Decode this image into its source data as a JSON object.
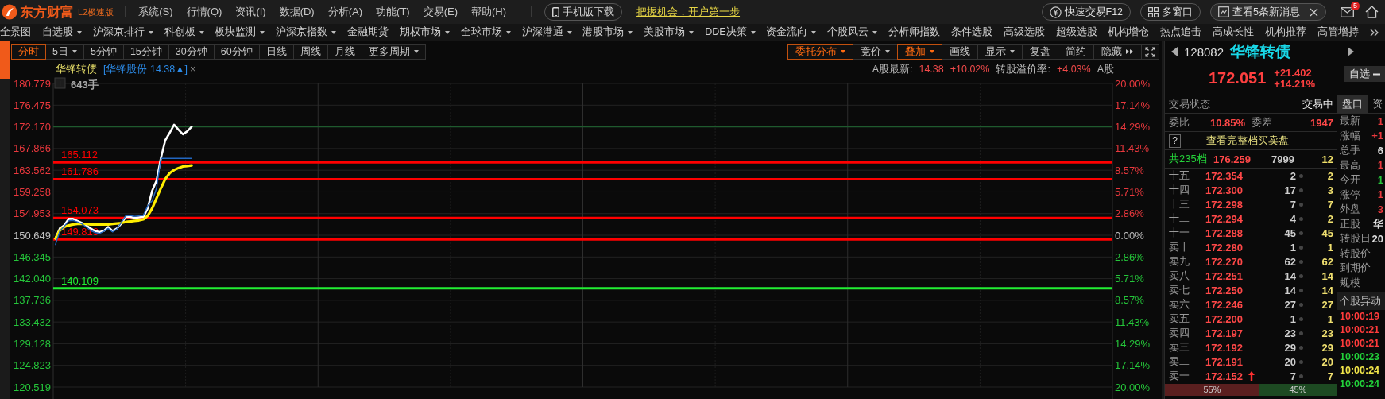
{
  "top_bar": {
    "logo": "东方财富",
    "edition": "L2极速版",
    "menus": [
      "系统(S)",
      "行情(Q)",
      "资讯(I)",
      "数据(D)",
      "分析(A)",
      "功能(T)",
      "交易(E)",
      "帮助(H)"
    ],
    "mobile_download": "手机版下载",
    "promo": "把握机会，开户第一步",
    "quick_trade": "快速交易F12",
    "multi_window": "多窗口",
    "news": "查看5条新消息",
    "mail_badge": "5"
  },
  "nav": [
    {
      "label": "全景图",
      "dropdown": false
    },
    {
      "label": "自选股",
      "dropdown": true
    },
    {
      "label": "沪深京排行",
      "dropdown": true
    },
    {
      "label": "科创板",
      "dropdown": true
    },
    {
      "label": "板块监测",
      "dropdown": true
    },
    {
      "label": "沪深京指数",
      "dropdown": true
    },
    {
      "label": "金融期货",
      "dropdown": false
    },
    {
      "label": "期权市场",
      "dropdown": true
    },
    {
      "label": "全球市场",
      "dropdown": true
    },
    {
      "label": "沪深港通",
      "dropdown": true
    },
    {
      "label": "港股市场",
      "dropdown": true
    },
    {
      "label": "美股市场",
      "dropdown": true
    },
    {
      "label": "DDE决策",
      "dropdown": true
    },
    {
      "label": "资金流向",
      "dropdown": true
    },
    {
      "label": "个股风云",
      "dropdown": true
    },
    {
      "label": "分析师指数",
      "dropdown": false
    },
    {
      "label": "条件选股",
      "dropdown": false
    },
    {
      "label": "高级选股",
      "dropdown": false
    },
    {
      "label": "超级选股",
      "dropdown": false
    },
    {
      "label": "机构增仓",
      "dropdown": false
    },
    {
      "label": "热点追击",
      "dropdown": false
    },
    {
      "label": "高成长性",
      "dropdown": false
    },
    {
      "label": "机构推荐",
      "dropdown": false
    },
    {
      "label": "高管增持",
      "dropdown": false
    }
  ],
  "period_tabs": [
    {
      "label": "分时",
      "selected": true,
      "dropdown": false
    },
    {
      "label": "5日",
      "selected": false,
      "dropdown": true
    },
    {
      "label": "5分钟",
      "selected": false,
      "dropdown": false
    },
    {
      "label": "15分钟",
      "selected": false,
      "dropdown": false
    },
    {
      "label": "30分钟",
      "selected": false,
      "dropdown": false
    },
    {
      "label": "60分钟",
      "selected": false,
      "dropdown": false
    },
    {
      "label": "日线",
      "selected": false,
      "dropdown": false
    },
    {
      "label": "周线",
      "selected": false,
      "dropdown": false
    },
    {
      "label": "月线",
      "selected": false,
      "dropdown": false
    },
    {
      "label": "更多周期",
      "selected": false,
      "dropdown": true
    }
  ],
  "chart_tools": [
    {
      "label": "委托分布",
      "active": true,
      "dropdown": true
    },
    {
      "label": "竞价",
      "active": false,
      "dropdown": true
    },
    {
      "label": "叠加",
      "active": true,
      "dropdown": true
    },
    {
      "label": "画线",
      "active": false,
      "dropdown": false
    },
    {
      "label": "显示",
      "active": false,
      "dropdown": true
    },
    {
      "label": "复盘",
      "active": false,
      "dropdown": false
    },
    {
      "label": "简约",
      "active": false,
      "dropdown": false
    },
    {
      "label": "隐藏",
      "active": false,
      "dropdown": false
    }
  ],
  "chart": {
    "title": "华锋转债",
    "overlay": "[华锋股份 14.38▲]",
    "close": "×",
    "add": "+",
    "volume_label": "643手",
    "a_share_info": [
      {
        "text": "A股最新:",
        "color": "#bdbdbd"
      },
      {
        "text": "14.38",
        "color": "#ef4a4a"
      },
      {
        "text": "+10.02%",
        "color": "#ef4a4a"
      },
      {
        "text": "转股溢价率:",
        "color": "#bdbdbd"
      },
      {
        "text": "+4.03%",
        "color": "#ef4a4a"
      },
      {
        "text": "A股",
        "color": "#bdbdbd"
      }
    ],
    "percent_axis": [
      {
        "label": "20.00%",
        "color": "#e8383d"
      },
      {
        "label": "17.14%",
        "color": "#e8383d"
      },
      {
        "label": "14.29%",
        "color": "#e8383d"
      },
      {
        "label": "11.43%",
        "color": "#e8383d"
      },
      {
        "label": "8.57%",
        "color": "#e8383d"
      },
      {
        "label": "5.71%",
        "color": "#e8383d"
      },
      {
        "label": "2.86%",
        "color": "#e8383d"
      },
      {
        "label": "0.00%",
        "color": "#bdbdbd"
      },
      {
        "label": "2.86%",
        "color": "#25c53a"
      },
      {
        "label": "5.71%",
        "color": "#25c53a"
      },
      {
        "label": "8.57%",
        "color": "#25c53a"
      },
      {
        "label": "11.43%",
        "color": "#25c53a"
      },
      {
        "label": "14.29%",
        "color": "#25c53a"
      },
      {
        "label": "17.14%",
        "color": "#25c53a"
      },
      {
        "label": "20.00%",
        "color": "#25c53a"
      }
    ],
    "chart_data": {
      "type": "line",
      "grid": true,
      "categories": [
        null,
        null,
        null,
        null,
        null,
        null,
        null,
        null,
        null,
        null,
        null,
        null,
        null,
        null,
        null,
        null,
        null,
        null,
        null,
        null,
        null,
        null,
        null,
        null,
        null,
        null,
        null,
        null,
        null,
        null,
        null,
        null,
        null,
        null,
        null,
        null,
        null,
        null,
        null,
        null,
        null,
        null,
        null,
        null,
        null,
        null,
        null,
        null,
        null,
        null,
        null,
        null,
        null,
        null,
        null,
        null,
        null,
        null,
        null,
        null,
        null,
        null,
        null,
        null,
        null,
        null,
        null,
        null,
        null,
        null,
        null,
        null,
        null,
        null,
        null,
        null,
        null,
        null,
        null,
        null,
        null,
        null,
        null,
        null,
        null,
        null,
        null,
        null,
        null,
        null,
        null,
        null,
        null,
        null,
        null,
        null,
        null,
        null,
        null,
        null,
        null,
        null,
        null,
        null,
        null,
        null,
        null,
        null,
        null,
        null,
        null,
        null,
        null,
        null,
        null,
        null,
        null,
        null,
        null,
        null,
        null,
        null,
        null,
        null,
        null,
        null,
        null,
        null,
        null,
        null,
        null,
        null,
        null,
        null,
        null,
        null,
        null,
        null,
        null,
        null,
        null,
        null,
        null,
        null,
        null,
        null,
        null,
        null,
        null,
        null,
        null,
        null,
        null,
        null,
        null,
        null,
        null,
        null,
        null,
        null,
        null,
        null,
        null,
        null,
        null,
        null,
        null,
        null,
        null,
        null,
        null,
        null,
        null,
        null,
        null,
        null,
        null,
        null,
        null,
        null,
        null,
        null,
        null,
        null,
        null,
        null,
        null,
        null,
        null,
        null,
        null,
        null,
        null,
        null,
        null,
        null,
        null,
        null,
        null,
        null,
        null,
        null,
        null,
        null,
        null,
        null,
        null,
        null,
        null,
        null,
        null,
        null,
        null,
        null,
        null,
        null,
        null,
        null,
        null,
        null,
        null,
        null,
        null,
        null,
        null,
        null,
        null,
        null,
        null,
        null,
        null,
        null,
        null,
        null,
        null,
        null,
        null,
        null,
        null,
        null,
        null
      ],
      "ylim": [
        120.519,
        180.779
      ],
      "ref_lines": [
        {
          "axis": "y",
          "value": 172.17,
          "color": "#1f5a2e"
        },
        {
          "axis": "y",
          "value": 165.112,
          "label": "165.112",
          "color": "#ff0000"
        },
        {
          "axis": "y",
          "value": 161.786,
          "label": "161.786",
          "color": "#ff0000"
        },
        {
          "axis": "y",
          "value": 154.073,
          "label": "154.073",
          "color": "#ff0000"
        },
        {
          "axis": "y",
          "value": 149.813,
          "label": "149.813",
          "color": "#ff0000"
        },
        {
          "axis": "y",
          "value": 140.109,
          "label": "140.109",
          "color": "#22ee33"
        }
      ],
      "yticks": [
        {
          "value": 180.779,
          "label": "180.779"
        },
        {
          "value": 176.475,
          "label": "176.475"
        },
        {
          "value": 172.17,
          "label": "172.170"
        },
        {
          "value": 167.866,
          "label": "167.866"
        },
        {
          "value": 163.562,
          "label": "163.562"
        },
        {
          "value": 159.258,
          "label": "159.258"
        },
        {
          "value": 154.953,
          "label": "154.953"
        },
        {
          "value": 150.649,
          "label": "150.649"
        },
        {
          "value": 146.345,
          "label": "146.345"
        },
        {
          "value": 142.04,
          "label": "142.040"
        },
        {
          "value": 137.736,
          "label": "137.736"
        },
        {
          "value": 133.432,
          "label": "133.432"
        },
        {
          "value": 129.128,
          "label": "129.128"
        },
        {
          "value": 124.823,
          "label": "124.823"
        },
        {
          "value": 120.519,
          "label": "120.519"
        }
      ],
      "series": [
        {
          "color": "#ffffff",
          "values": [
            150.0,
            152.0,
            152.6,
            153.9,
            153.9,
            153.5,
            153.1,
            152.6,
            152.0,
            151.5,
            151.3,
            151.5,
            152.3,
            151.5,
            152.0,
            153.0,
            154.3,
            154.3,
            154.1,
            154.2,
            154.3,
            156.0,
            159.5,
            161.5,
            166.0,
            169.5,
            171.0,
            172.6,
            171.6,
            170.7,
            171.3,
            172.2,
            null,
            null,
            null,
            null,
            null,
            null,
            null,
            null,
            null,
            null,
            null,
            null,
            null,
            null,
            null,
            null,
            null,
            null,
            null,
            null,
            null,
            null,
            null,
            null,
            null,
            null,
            null,
            null,
            null,
            null,
            null,
            null,
            null,
            null,
            null,
            null,
            null,
            null,
            null,
            null,
            null,
            null,
            null,
            null,
            null,
            null,
            null,
            null,
            null,
            null,
            null,
            null,
            null,
            null,
            null,
            null,
            null,
            null,
            null,
            null,
            null,
            null,
            null,
            null,
            null,
            null,
            null,
            null,
            null,
            null,
            null,
            null,
            null,
            null,
            null,
            null,
            null,
            null,
            null,
            null,
            null,
            null,
            null,
            null,
            null,
            null,
            null,
            null,
            null,
            null,
            null,
            null,
            null,
            null,
            null,
            null,
            null,
            null,
            null,
            null,
            null,
            null,
            null,
            null,
            null,
            null,
            null,
            null,
            null,
            null,
            null,
            null,
            null,
            null,
            null,
            null,
            null,
            null,
            null,
            null,
            null,
            null,
            null,
            null,
            null,
            null,
            null,
            null,
            null,
            null,
            null,
            null,
            null,
            null,
            null,
            null,
            null,
            null,
            null,
            null,
            null,
            null,
            null,
            null,
            null,
            null,
            null,
            null,
            null,
            null,
            null,
            null,
            null,
            null,
            null,
            null,
            null,
            null,
            null,
            null,
            null,
            null,
            null,
            null,
            null,
            null,
            null,
            null,
            null,
            null,
            null,
            null,
            null,
            null,
            null,
            null,
            null,
            null,
            null,
            null,
            null,
            null,
            null,
            null,
            null,
            null,
            null,
            null,
            null,
            null,
            null,
            null,
            null,
            null,
            null,
            null,
            null,
            null,
            null,
            null,
            null,
            null,
            null,
            null,
            null,
            null,
            null,
            null,
            null
          ]
        },
        {
          "color": "#ffee00",
          "values": [
            150.0,
            151.6,
            152.3,
            152.6,
            152.8,
            152.9,
            152.9,
            152.9,
            152.8,
            152.8,
            152.8,
            152.8,
            152.8,
            152.9,
            153.0,
            153.1,
            153.3,
            153.4,
            153.5,
            153.6,
            153.8,
            154.5,
            156.0,
            158.0,
            160.0,
            161.8,
            163.0,
            163.6,
            164.0,
            164.3,
            164.4,
            164.5,
            null,
            null,
            null,
            null,
            null,
            null,
            null,
            null,
            null,
            null,
            null,
            null,
            null,
            null,
            null,
            null,
            null,
            null,
            null,
            null,
            null,
            null,
            null,
            null,
            null,
            null,
            null,
            null,
            null,
            null,
            null,
            null,
            null,
            null,
            null,
            null,
            null,
            null,
            null,
            null,
            null,
            null,
            null,
            null,
            null,
            null,
            null,
            null,
            null,
            null,
            null,
            null,
            null,
            null,
            null,
            null,
            null,
            null,
            null,
            null,
            null,
            null,
            null,
            null,
            null,
            null,
            null,
            null,
            null,
            null,
            null,
            null,
            null,
            null,
            null,
            null,
            null,
            null,
            null,
            null,
            null,
            null,
            null,
            null,
            null,
            null,
            null,
            null,
            null,
            null,
            null,
            null,
            null,
            null,
            null,
            null,
            null,
            null,
            null,
            null,
            null,
            null,
            null,
            null,
            null,
            null,
            null,
            null,
            null,
            null,
            null,
            null,
            null,
            null,
            null,
            null,
            null,
            null,
            null,
            null,
            null,
            null,
            null,
            null,
            null,
            null,
            null,
            null,
            null,
            null,
            null,
            null,
            null,
            null,
            null,
            null,
            null,
            null,
            null,
            null,
            null,
            null,
            null,
            null,
            null,
            null,
            null,
            null,
            null,
            null,
            null,
            null,
            null,
            null,
            null,
            null,
            null,
            null,
            null,
            null,
            null,
            null,
            null,
            null,
            null,
            null,
            null,
            null,
            null,
            null,
            null,
            null,
            null,
            null,
            null,
            null,
            null,
            null,
            null,
            null,
            null,
            null,
            null,
            null,
            null,
            null,
            null,
            null,
            null,
            null,
            null,
            null,
            null,
            null,
            null,
            null,
            null,
            null,
            null,
            null,
            null,
            null,
            null,
            null,
            null,
            null,
            null,
            null,
            null
          ]
        },
        {
          "color": "#2266c0",
          "values": [
            148.8,
            151.5,
            152.4,
            153.5,
            153.6,
            153.3,
            152.9,
            152.3,
            151.6,
            151.2,
            151.0,
            151.4,
            152.0,
            151.3,
            151.9,
            153.2,
            154.5,
            154.6,
            154.4,
            154.5,
            154.6,
            156.5,
            157.5,
            160.0,
            165.9,
            165.9,
            165.9,
            165.9,
            165.9,
            165.9,
            165.9,
            165.9,
            null,
            null,
            null,
            null,
            null,
            null,
            null,
            null,
            null,
            null,
            null,
            null,
            null,
            null,
            null,
            null,
            null,
            null,
            null,
            null,
            null,
            null,
            null,
            null,
            null,
            null,
            null,
            null,
            null,
            null,
            null,
            null,
            null,
            null,
            null,
            null,
            null,
            null,
            null,
            null,
            null,
            null,
            null,
            null,
            null,
            null,
            null,
            null,
            null,
            null,
            null,
            null,
            null,
            null,
            null,
            null,
            null,
            null,
            null,
            null,
            null,
            null,
            null,
            null,
            null,
            null,
            null,
            null,
            null,
            null,
            null,
            null,
            null,
            null,
            null,
            null,
            null,
            null,
            null,
            null,
            null,
            null,
            null,
            null,
            null,
            null,
            null,
            null,
            null,
            null,
            null,
            null,
            null,
            null,
            null,
            null,
            null,
            null,
            null,
            null,
            null,
            null,
            null,
            null,
            null,
            null,
            null,
            null,
            null,
            null,
            null,
            null,
            null,
            null,
            null,
            null,
            null,
            null,
            null,
            null,
            null,
            null,
            null,
            null,
            null,
            null,
            null,
            null,
            null,
            null,
            null,
            null,
            null,
            null,
            null,
            null,
            null,
            null,
            null,
            null,
            null,
            null,
            null,
            null,
            null,
            null,
            null,
            null,
            null,
            null,
            null,
            null,
            null,
            null,
            null,
            null,
            null,
            null,
            null,
            null,
            null,
            null,
            null,
            null,
            null,
            null,
            null,
            null,
            null,
            null,
            null,
            null,
            null,
            null,
            null,
            null,
            null,
            null,
            null,
            null,
            null,
            null,
            null,
            null,
            null,
            null,
            null,
            null,
            null,
            null,
            null,
            null,
            null,
            null,
            null,
            null,
            null,
            null,
            null,
            null,
            null,
            null,
            null,
            null,
            null,
            null,
            null,
            null,
            null
          ]
        }
      ]
    }
  },
  "quote": {
    "code": "128082",
    "name": "华锋转债",
    "price": "172.051",
    "change": "+21.402",
    "change_pct": "+14.21%",
    "watch": "自选"
  },
  "book": {
    "status_label": "交易状态",
    "status_value": "交易中",
    "ratio_label": "委比",
    "ratio_value": "10.85%",
    "diff_label": "委差",
    "diff_value": "1947",
    "help": "?",
    "full_book": "查看完整档买卖盘",
    "total_label": "共235档",
    "total_price": "176.259",
    "total_volume": "7999",
    "total_count": "12",
    "asks": [
      {
        "level": "十五",
        "price": "172.354",
        "volume": "2",
        "count": "2",
        "uptick": false
      },
      {
        "level": "十四",
        "price": "172.300",
        "volume": "17",
        "count": "3",
        "uptick": false
      },
      {
        "level": "十三",
        "price": "172.298",
        "volume": "7",
        "count": "7",
        "uptick": false
      },
      {
        "level": "十二",
        "price": "172.294",
        "volume": "4",
        "count": "2",
        "uptick": false
      },
      {
        "level": "十一",
        "price": "172.288",
        "volume": "45",
        "count": "45",
        "uptick": false
      },
      {
        "level": "卖十",
        "price": "172.280",
        "volume": "1",
        "count": "1",
        "uptick": false
      },
      {
        "level": "卖九",
        "price": "172.270",
        "volume": "62",
        "count": "62",
        "uptick": false
      },
      {
        "level": "卖八",
        "price": "172.251",
        "volume": "14",
        "count": "14",
        "uptick": false
      },
      {
        "level": "卖七",
        "price": "172.250",
        "volume": "14",
        "count": "14",
        "uptick": false
      },
      {
        "level": "卖六",
        "price": "172.246",
        "volume": "27",
        "count": "27",
        "uptick": false
      },
      {
        "level": "卖五",
        "price": "172.200",
        "volume": "1",
        "count": "1",
        "uptick": false
      },
      {
        "level": "卖四",
        "price": "172.197",
        "volume": "23",
        "count": "23",
        "uptick": false
      },
      {
        "level": "卖三",
        "price": "172.192",
        "volume": "29",
        "count": "29",
        "uptick": false
      },
      {
        "level": "卖二",
        "price": "172.191",
        "volume": "20",
        "count": "20",
        "uptick": false
      },
      {
        "level": "卖一",
        "price": "172.152",
        "volume": "7",
        "count": "7",
        "uptick": true
      }
    ],
    "ratio_bar": [
      {
        "label": "55%",
        "level": 0.55,
        "color": "#5a1f1f"
      },
      {
        "label": "45%",
        "level": 0.45,
        "color": "#1d4a22"
      }
    ]
  },
  "side": {
    "tabs": [
      {
        "label": "盘口",
        "selected": true
      },
      {
        "label": "资",
        "selected": false
      }
    ],
    "fields": [
      {
        "label": "最新",
        "value": "1",
        "color": "#e8383d"
      },
      {
        "label": "涨幅",
        "value": "+1",
        "color": "#e8383d"
      },
      {
        "label": "总手",
        "value": "6",
        "color": "#dddddd"
      },
      {
        "label": "最高",
        "value": "1",
        "color": "#e8383d"
      },
      {
        "label": "今开",
        "value": "1",
        "color": "#25c53a"
      },
      {
        "label": "涨停",
        "value": "1",
        "color": "#e8383d"
      },
      {
        "label": "外盘",
        "value": "3",
        "color": "#e8383d"
      },
      {
        "label": "正股",
        "value": "华",
        "color": "#dddddd"
      },
      {
        "label": "转股日",
        "value": "20",
        "color": "#dddddd"
      },
      {
        "label": "转股价"
      },
      {
        "label": "到期价"
      },
      {
        "label": "规模"
      }
    ],
    "alerts_title": "个股异动",
    "alerts": [
      {
        "time": "10:00:19",
        "color": "#ff3b3b"
      },
      {
        "time": "10:00:21",
        "color": "#ff3b3b"
      },
      {
        "time": "10:00:21",
        "color": "#ff3b3b"
      },
      {
        "time": "10:00:23",
        "color": "#22d23a"
      },
      {
        "time": "10:00:24",
        "color": "#f2e64a"
      },
      {
        "time": "10:00:24",
        "color": "#22d23a"
      }
    ]
  }
}
